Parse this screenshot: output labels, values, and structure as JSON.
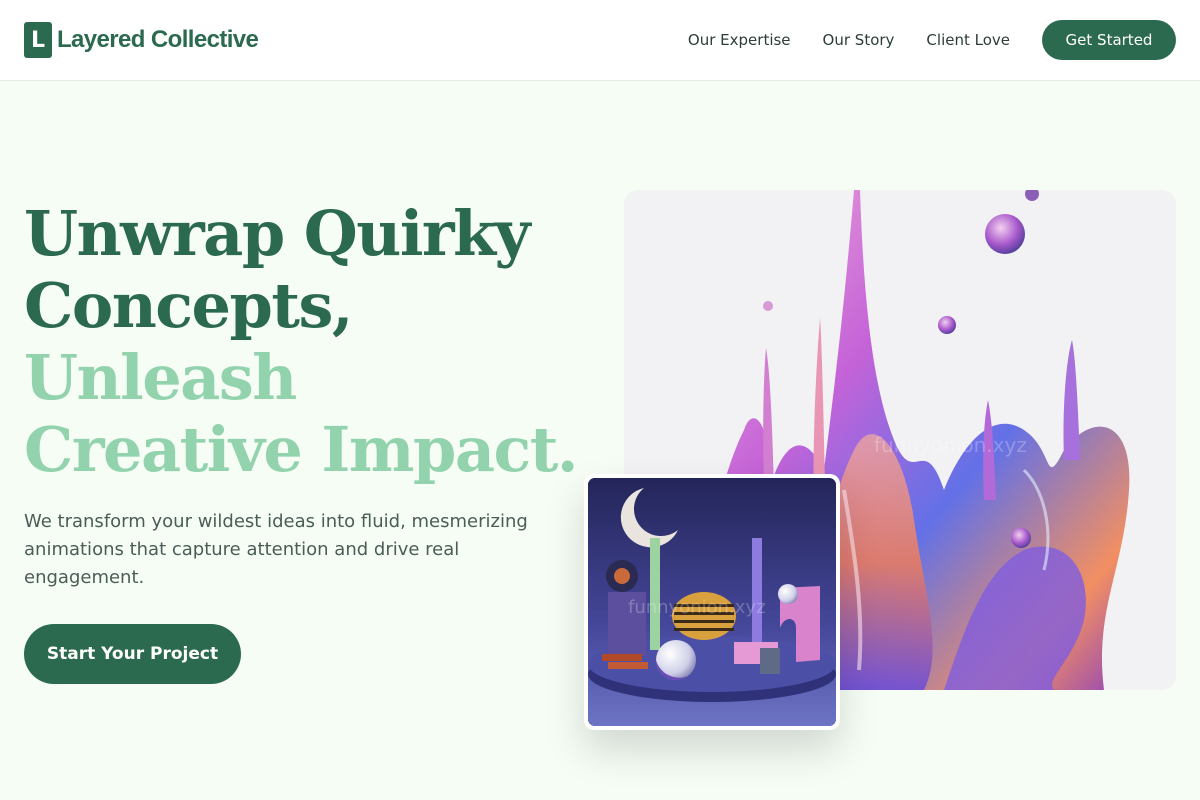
{
  "brand": {
    "logo_letter": "L",
    "name": "Layered Collective"
  },
  "nav": {
    "links": [
      "Our Expertise",
      "Our Story",
      "Client Love"
    ],
    "cta": "Get Started"
  },
  "hero": {
    "title_line1": "Unwrap Quirky",
    "title_line2": "Concepts,",
    "title_line3": "Unleash",
    "title_line4": "Creative Impact.",
    "description": "We transform your wildest ideas into fluid, mesmerizing animations that capture attention and drive real engagement.",
    "cta": "Start Your Project"
  },
  "images": {
    "main_alt_watermark": "funnyonion.xyz",
    "card_watermark": "funnyonion.xyz"
  },
  "colors": {
    "primary": "#2c6a4f",
    "accent_light": "#92d3ad",
    "background": "#f5fdf5"
  }
}
